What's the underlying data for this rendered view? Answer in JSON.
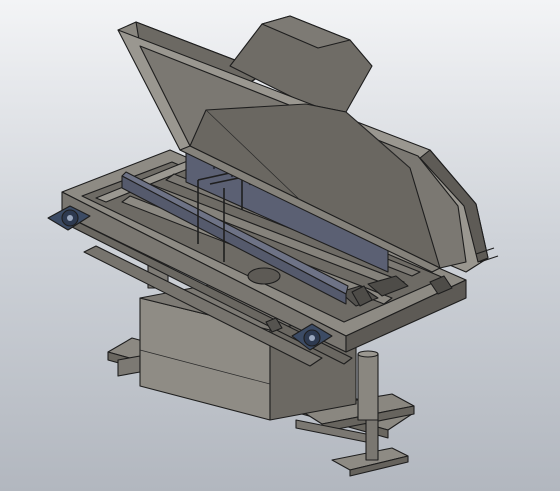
{
  "scene": {
    "background_top": "#f3f4f6",
    "background_bottom": "#b2b7bf",
    "metal_light": "#9a9790",
    "metal_mid": "#8a8780",
    "metal_dark": "#6f6c66",
    "metal_shadow": "#55534f",
    "blue_plate": "#5d6274",
    "bearing_blue": "#3c4b64"
  }
}
